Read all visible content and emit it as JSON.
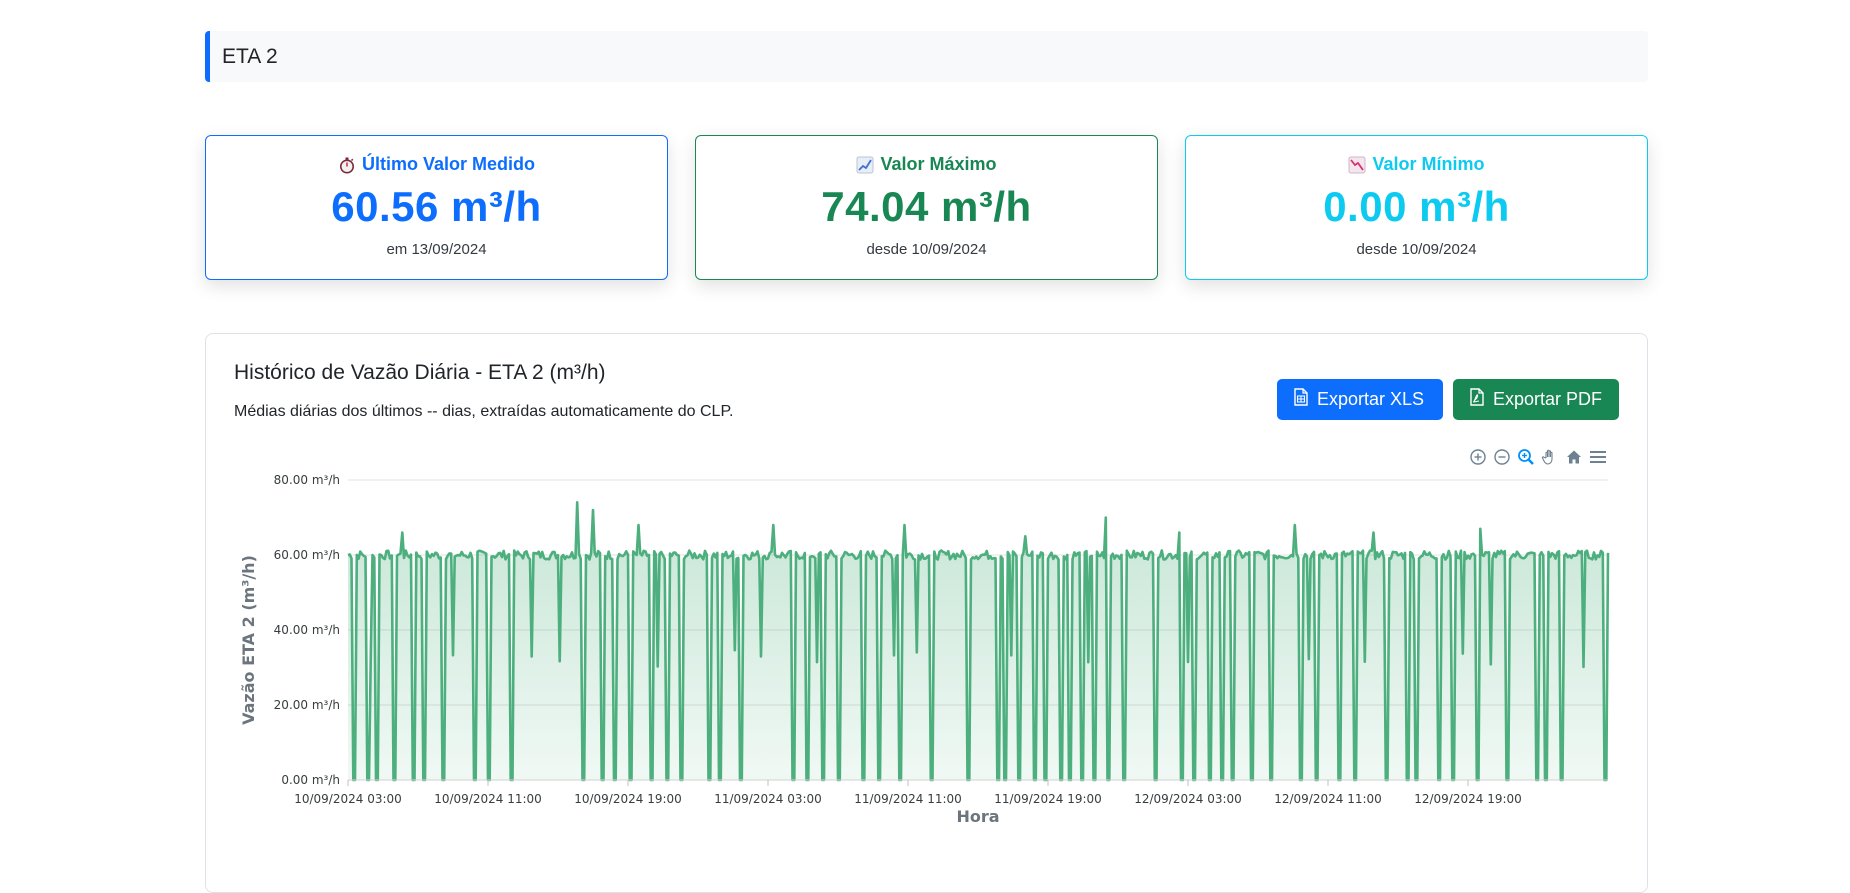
{
  "header": {
    "title": "ETA 2"
  },
  "cards": {
    "last": {
      "icon": "stopwatch-icon",
      "title": "Último Valor Medido",
      "value": "60.56 m³/h",
      "sub": "em 13/09/2024",
      "color": "#0d6efd"
    },
    "max": {
      "icon": "chart-up-icon",
      "title": "Valor Máximo",
      "value": "74.04 m³/h",
      "sub": "desde 10/09/2024",
      "color": "#198754"
    },
    "min": {
      "icon": "chart-down-icon",
      "title": "Valor Mínimo",
      "value": "0.00 m³/h",
      "sub": "desde 10/09/2024",
      "color": "#0dcaf0"
    }
  },
  "chart_section": {
    "title": "Histórico de Vazão Diária - ETA 2 (m³/h)",
    "description": "Médias diárias dos últimos -- dias, extraídas automaticamente do CLP.",
    "export_xls": "Exportar XLS",
    "export_pdf": "Exportar PDF",
    "toolbar": [
      "zoom-in-icon",
      "zoom-out-icon",
      "selection-zoom-icon",
      "pan-hand-icon",
      "reset-home-icon",
      "menu-icon"
    ]
  },
  "chart_data": {
    "type": "area",
    "xlabel": "Hora",
    "ylabel": "Vazão ETA 2 (m³/h)",
    "ylim": [
      0,
      80
    ],
    "yticks": [
      "0.00 m³/h",
      "20.00 m³/h",
      "40.00 m³/h",
      "60.00 m³/h",
      "80.00 m³/h"
    ],
    "xticks": [
      "10/09/2024 03:00",
      "10/09/2024 11:00",
      "10/09/2024 19:00",
      "11/09/2024 03:00",
      "11/09/2024 11:00",
      "11/09/2024 19:00",
      "12/09/2024 03:00",
      "12/09/2024 11:00",
      "12/09/2024 19:00"
    ],
    "x_range": [
      "10/09/2024 03:00",
      "13/09/2024 03:00"
    ],
    "series": [
      {
        "color": "#4caf7d",
        "typical_value": 60,
        "max_value": 74.04,
        "min_value": 0,
        "drops_to_zero_at_hours": [
          0.3,
          1.1,
          1.6,
          2.6,
          3.7,
          4.3,
          5.4,
          7.2,
          8.0,
          9.3,
          13.4,
          14.5,
          15.2,
          16.1,
          17.3,
          18.2,
          19.0,
          20.6,
          21.2,
          22.4,
          25.4,
          26.2,
          27.1,
          28.0,
          29.4,
          30.3,
          31.5,
          33.3,
          35.4,
          37.1,
          37.5,
          38.3,
          39.2,
          39.8,
          40.7,
          41.2,
          41.9,
          42.6,
          43.4,
          44.3,
          46.1,
          47.6,
          48.3,
          49.2,
          49.9,
          50.5,
          51.6,
          52.7,
          54.4,
          55.3,
          56.6,
          57.5,
          59.3,
          60.5,
          61.0,
          62.3,
          63.1,
          64.5,
          66.2,
          67.9,
          68.4,
          69.3,
          71.8
        ],
        "dips_at_hours": [
          1.3,
          6.0,
          10.5,
          12.1,
          17.7,
          22.1,
          23.6,
          26.8,
          31.2,
          32.5,
          37.9,
          42.3,
          48.0,
          54.9,
          58.1,
          63.7,
          65.3,
          70.6
        ],
        "peaks": [
          [
            3.1,
            66
          ],
          [
            13.1,
            74.04
          ],
          [
            14.0,
            72
          ],
          [
            16.6,
            68
          ],
          [
            24.3,
            68
          ],
          [
            31.8,
            68
          ],
          [
            38.7,
            65
          ],
          [
            43.3,
            70
          ],
          [
            47.5,
            66
          ],
          [
            54.1,
            68
          ],
          [
            58.6,
            66
          ],
          [
            64.7,
            67
          ]
        ]
      }
    ]
  }
}
